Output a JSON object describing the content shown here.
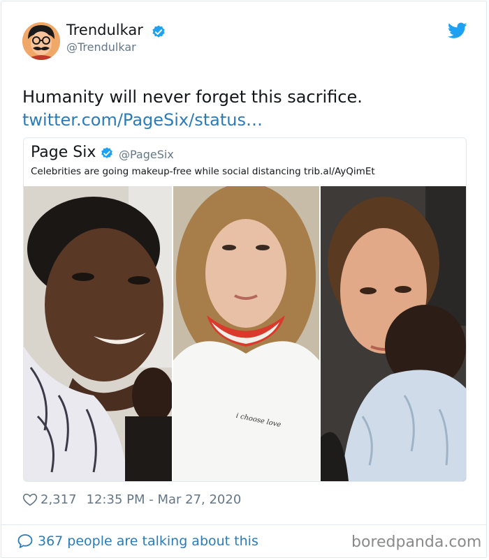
{
  "author": {
    "name": "Trendulkar",
    "handle": "@Trendulkar",
    "verified_icon": "verified-badge-icon",
    "avatar_icon": "avatar-cartoon-glasses-mustache"
  },
  "tweet": {
    "text": "Humanity will never forget this sacrifice.",
    "link": "twitter.com/PageSix/status…"
  },
  "quoted_tweet": {
    "name": "Page Six",
    "handle": "@PageSix",
    "text": "Celebrities are going makeup-free while social distancing trib.al/AyQimEt",
    "photos": [
      "selfie-photo-1",
      "selfie-photo-2",
      "selfie-photo-3"
    ],
    "photo2_caption": "i choose love"
  },
  "stats": {
    "likes": "2,317",
    "timestamp": "12:35 PM - Mar 27, 2020"
  },
  "footer": {
    "talking": "367 people are talking about this",
    "watermark": "boredpanda.com"
  },
  "colors": {
    "link": "#2b7bb9",
    "verified": "#1da1f2",
    "muted": "#657786",
    "border": "#e1e8ed"
  }
}
